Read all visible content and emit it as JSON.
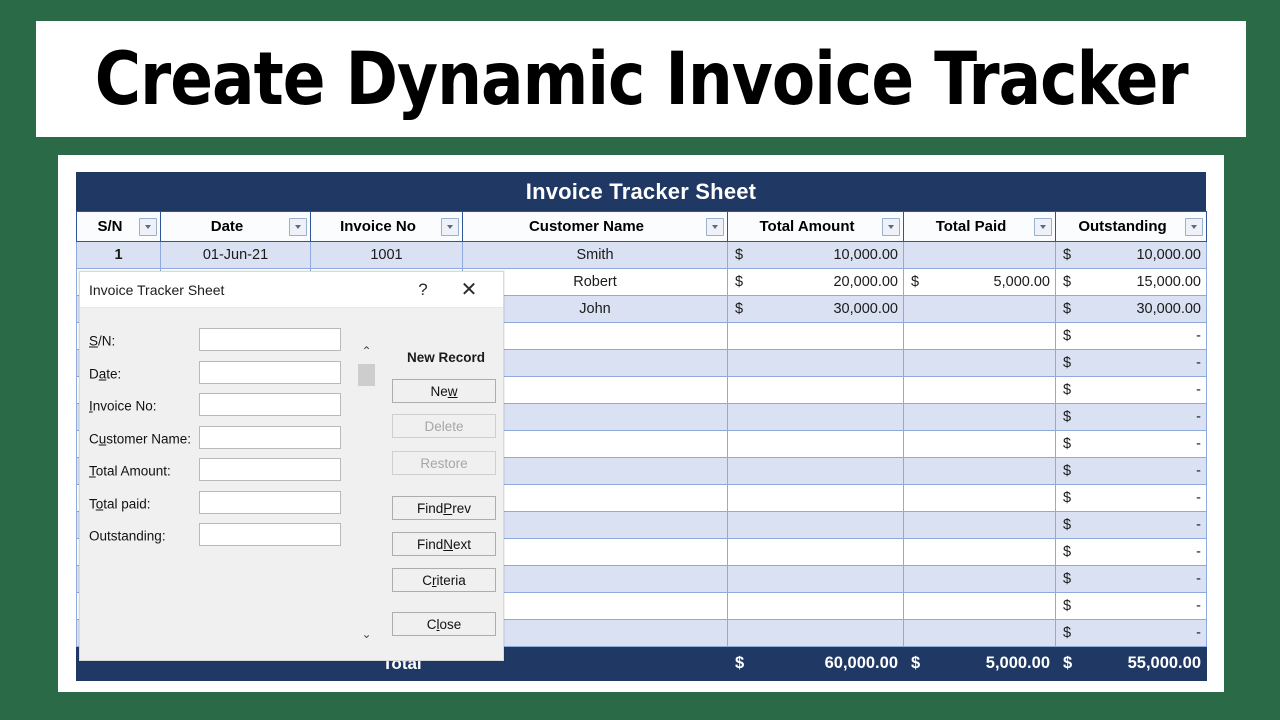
{
  "theme": {
    "background_green": "#2b6a46",
    "header_navy": "#1f3864",
    "band_blue": "#d9e1f2",
    "grid_blue": "#8ea9db"
  },
  "banner": {
    "title": "Create Dynamic Invoice Tracker"
  },
  "sheet": {
    "title": "Invoice Tracker Sheet",
    "columns": [
      "S/N",
      "Date",
      "Invoice No",
      "Customer Name",
      "Total Amount",
      "Total Paid",
      "Outstanding"
    ],
    "rows": [
      {
        "sn": "1",
        "date": "01-Jun-21",
        "invoice": "1001",
        "name": "Smith",
        "amount_cur": "$",
        "amount": "10,000.00",
        "paid_cur": "",
        "paid": "",
        "out_cur": "$",
        "out": "10,000.00"
      },
      {
        "sn": "",
        "date": "",
        "invoice": "",
        "name": "Robert",
        "amount_cur": "$",
        "amount": "20,000.00",
        "paid_cur": "$",
        "paid": "5,000.00",
        "out_cur": "$",
        "out": "15,000.00"
      },
      {
        "sn": "",
        "date": "",
        "invoice": "",
        "name": "John",
        "amount_cur": "$",
        "amount": "30,000.00",
        "paid_cur": "",
        "paid": "",
        "out_cur": "$",
        "out": "30,000.00"
      },
      {
        "sn": "",
        "date": "",
        "invoice": "",
        "name": "",
        "amount_cur": "",
        "amount": "",
        "paid_cur": "",
        "paid": "",
        "out_cur": "$",
        "out": "-"
      },
      {
        "sn": "",
        "date": "",
        "invoice": "",
        "name": "",
        "amount_cur": "",
        "amount": "",
        "paid_cur": "",
        "paid": "",
        "out_cur": "$",
        "out": "-"
      },
      {
        "sn": "",
        "date": "",
        "invoice": "",
        "name": "",
        "amount_cur": "",
        "amount": "",
        "paid_cur": "",
        "paid": "",
        "out_cur": "$",
        "out": "-"
      },
      {
        "sn": "",
        "date": "",
        "invoice": "",
        "name": "",
        "amount_cur": "",
        "amount": "",
        "paid_cur": "",
        "paid": "",
        "out_cur": "$",
        "out": "-"
      },
      {
        "sn": "",
        "date": "",
        "invoice": "",
        "name": "",
        "amount_cur": "",
        "amount": "",
        "paid_cur": "",
        "paid": "",
        "out_cur": "$",
        "out": "-"
      },
      {
        "sn": "",
        "date": "",
        "invoice": "",
        "name": "",
        "amount_cur": "",
        "amount": "",
        "paid_cur": "",
        "paid": "",
        "out_cur": "$",
        "out": "-"
      },
      {
        "sn": "",
        "date": "",
        "invoice": "",
        "name": "",
        "amount_cur": "",
        "amount": "",
        "paid_cur": "",
        "paid": "",
        "out_cur": "$",
        "out": "-"
      },
      {
        "sn": "",
        "date": "",
        "invoice": "",
        "name": "",
        "amount_cur": "",
        "amount": "",
        "paid_cur": "",
        "paid": "",
        "out_cur": "$",
        "out": "-"
      },
      {
        "sn": "",
        "date": "",
        "invoice": "",
        "name": "",
        "amount_cur": "",
        "amount": "",
        "paid_cur": "",
        "paid": "",
        "out_cur": "$",
        "out": "-"
      },
      {
        "sn": "",
        "date": "",
        "invoice": "",
        "name": "",
        "amount_cur": "",
        "amount": "",
        "paid_cur": "",
        "paid": "",
        "out_cur": "$",
        "out": "-"
      },
      {
        "sn": "",
        "date": "",
        "invoice": "",
        "name": "",
        "amount_cur": "",
        "amount": "",
        "paid_cur": "",
        "paid": "",
        "out_cur": "$",
        "out": "-"
      },
      {
        "sn": "",
        "date": "",
        "invoice": "",
        "name": "",
        "amount_cur": "",
        "amount": "",
        "paid_cur": "",
        "paid": "",
        "out_cur": "$",
        "out": "-"
      }
    ],
    "total": {
      "label": "Total",
      "amount_cur": "$",
      "amount": "60,000.00",
      "paid_cur": "$",
      "paid": "5,000.00",
      "out_cur": "$",
      "out": "55,000.00"
    }
  },
  "dialog": {
    "title": "Invoice Tracker Sheet",
    "help_glyph": "?",
    "close_glyph": "✕",
    "scroll_up_glyph": "⌃",
    "scroll_down_glyph": "⌄",
    "record_status": "New Record",
    "fields": [
      {
        "label_pre": "",
        "label_u": "S",
        "label_post": "/N:",
        "value": ""
      },
      {
        "label_pre": "D",
        "label_u": "a",
        "label_post": "te:",
        "value": ""
      },
      {
        "label_pre": "",
        "label_u": "I",
        "label_post": "nvoice No:",
        "value": ""
      },
      {
        "label_pre": "C",
        "label_u": "u",
        "label_post": "stomer Name:",
        "value": ""
      },
      {
        "label_pre": "",
        "label_u": "T",
        "label_post": "otal Amount:",
        "value": ""
      },
      {
        "label_pre": "T",
        "label_u": "o",
        "label_post": "tal paid:",
        "value": ""
      },
      {
        "label_pre": "Outstandin",
        "label_u": "g",
        "label_post": ":",
        "value": ""
      }
    ],
    "buttons": [
      {
        "pre": "Ne",
        "u": "w",
        "post": "",
        "enabled": true
      },
      {
        "pre": "Delete",
        "u": "",
        "post": "",
        "enabled": false
      },
      {
        "pre": "Restore",
        "u": "",
        "post": "",
        "enabled": false
      },
      {
        "pre": "Find ",
        "u": "P",
        "post": "rev",
        "enabled": true
      },
      {
        "pre": "Find ",
        "u": "N",
        "post": "ext",
        "enabled": true
      },
      {
        "pre": "C",
        "u": "r",
        "post": "iteria",
        "enabled": true
      },
      {
        "pre": "C",
        "u": "l",
        "post": "ose",
        "enabled": true
      }
    ]
  }
}
